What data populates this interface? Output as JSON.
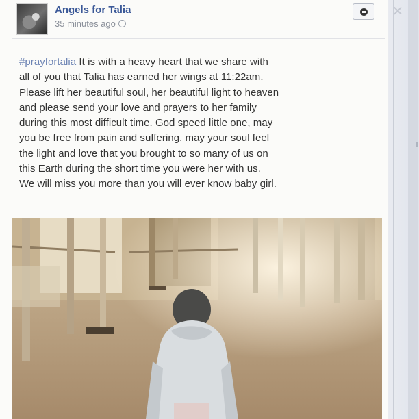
{
  "post": {
    "page_name": "Angels for Talia",
    "timestamp": "35 minutes ago",
    "hashtag": "#prayfortalia",
    "lines": [
      " It is with a heavy heart that we share with",
      "all of you that Talia has earned her wings at 11:22am.",
      "Please lift her beautiful soul, her beautiful light to heaven",
      "and please send your love and prayers to her family",
      "during this most difficult time. God speed little one, may",
      "you be free from pain and suffering, may your soul feel",
      "the light and love that you brought to so many of us on",
      "this Earth during the short time you were her with us.",
      "We will miss you more than you will ever know baby girl."
    ]
  },
  "icons": {
    "avatar": "page-avatar",
    "audience": "globe-icon",
    "options": "options-chevron-icon",
    "close": "close-icon"
  },
  "colors": {
    "link": "#3b5998",
    "hashtag": "#6d84b4",
    "text": "#333333",
    "meta": "#8a8f99"
  }
}
